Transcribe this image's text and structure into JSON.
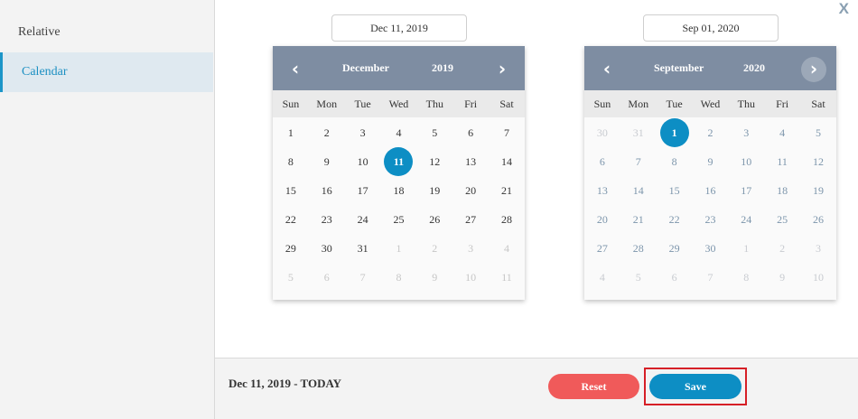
{
  "sidebar": {
    "items": [
      {
        "label": "Relative",
        "active": false
      },
      {
        "label": "Calendar",
        "active": true
      }
    ]
  },
  "close_label": "X",
  "start": {
    "date_field": "Dec 11, 2019",
    "month": "December",
    "year": "2019",
    "prev_icon": "‹",
    "next_icon": "›",
    "weekdays": [
      "Sun",
      "Mon",
      "Tue",
      "Wed",
      "Thu",
      "Fri",
      "Sat"
    ],
    "days": [
      {
        "d": "1",
        "in": true
      },
      {
        "d": "2",
        "in": true
      },
      {
        "d": "3",
        "in": true
      },
      {
        "d": "4",
        "in": true
      },
      {
        "d": "5",
        "in": true
      },
      {
        "d": "6",
        "in": true
      },
      {
        "d": "7",
        "in": true
      },
      {
        "d": "8",
        "in": true
      },
      {
        "d": "9",
        "in": true
      },
      {
        "d": "10",
        "in": true
      },
      {
        "d": "11",
        "in": true,
        "selected": true
      },
      {
        "d": "12",
        "in": true
      },
      {
        "d": "13",
        "in": true
      },
      {
        "d": "14",
        "in": true
      },
      {
        "d": "15",
        "in": true
      },
      {
        "d": "16",
        "in": true
      },
      {
        "d": "17",
        "in": true
      },
      {
        "d": "18",
        "in": true
      },
      {
        "d": "19",
        "in": true
      },
      {
        "d": "20",
        "in": true
      },
      {
        "d": "21",
        "in": true
      },
      {
        "d": "22",
        "in": true
      },
      {
        "d": "23",
        "in": true
      },
      {
        "d": "24",
        "in": true
      },
      {
        "d": "25",
        "in": true
      },
      {
        "d": "26",
        "in": true
      },
      {
        "d": "27",
        "in": true
      },
      {
        "d": "28",
        "in": true
      },
      {
        "d": "29",
        "in": true
      },
      {
        "d": "30",
        "in": true
      },
      {
        "d": "31",
        "in": true
      },
      {
        "d": "1",
        "in": false
      },
      {
        "d": "2",
        "in": false
      },
      {
        "d": "3",
        "in": false
      },
      {
        "d": "4",
        "in": false
      },
      {
        "d": "5",
        "in": false
      },
      {
        "d": "6",
        "in": false
      },
      {
        "d": "7",
        "in": false
      },
      {
        "d": "8",
        "in": false
      },
      {
        "d": "9",
        "in": false
      },
      {
        "d": "10",
        "in": false
      },
      {
        "d": "11",
        "in": false
      }
    ]
  },
  "end": {
    "date_field": "Sep 01, 2020",
    "month": "September",
    "year": "2020",
    "prev_icon": "‹",
    "next_icon": "›",
    "weekdays": [
      "Sun",
      "Mon",
      "Tue",
      "Wed",
      "Thu",
      "Fri",
      "Sat"
    ],
    "days": [
      {
        "d": "30",
        "in": false
      },
      {
        "d": "31",
        "in": false
      },
      {
        "d": "1",
        "in": true,
        "selected": true
      },
      {
        "d": "2",
        "in": true
      },
      {
        "d": "3",
        "in": true
      },
      {
        "d": "4",
        "in": true
      },
      {
        "d": "5",
        "in": true
      },
      {
        "d": "6",
        "in": true
      },
      {
        "d": "7",
        "in": true
      },
      {
        "d": "8",
        "in": true
      },
      {
        "d": "9",
        "in": true
      },
      {
        "d": "10",
        "in": true
      },
      {
        "d": "11",
        "in": true
      },
      {
        "d": "12",
        "in": true
      },
      {
        "d": "13",
        "in": true
      },
      {
        "d": "14",
        "in": true
      },
      {
        "d": "15",
        "in": true
      },
      {
        "d": "16",
        "in": true
      },
      {
        "d": "17",
        "in": true
      },
      {
        "d": "18",
        "in": true
      },
      {
        "d": "19",
        "in": true
      },
      {
        "d": "20",
        "in": true
      },
      {
        "d": "21",
        "in": true
      },
      {
        "d": "22",
        "in": true
      },
      {
        "d": "23",
        "in": true
      },
      {
        "d": "24",
        "in": true
      },
      {
        "d": "25",
        "in": true
      },
      {
        "d": "26",
        "in": true
      },
      {
        "d": "27",
        "in": true
      },
      {
        "d": "28",
        "in": true
      },
      {
        "d": "29",
        "in": true
      },
      {
        "d": "30",
        "in": true
      },
      {
        "d": "1",
        "in": false
      },
      {
        "d": "2",
        "in": false
      },
      {
        "d": "3",
        "in": false
      },
      {
        "d": "4",
        "in": false
      },
      {
        "d": "5",
        "in": false
      },
      {
        "d": "6",
        "in": false
      },
      {
        "d": "7",
        "in": false
      },
      {
        "d": "8",
        "in": false
      },
      {
        "d": "9",
        "in": false
      },
      {
        "d": "10",
        "in": false
      }
    ]
  },
  "footer": {
    "summary": "Dec 11, 2019 - TODAY",
    "reset_label": "Reset",
    "save_label": "Save"
  },
  "colors": {
    "accent": "#0d8ec4",
    "header": "#7e8da2",
    "reset": "#f05a5a",
    "highlight_outline": "#d61f26"
  }
}
